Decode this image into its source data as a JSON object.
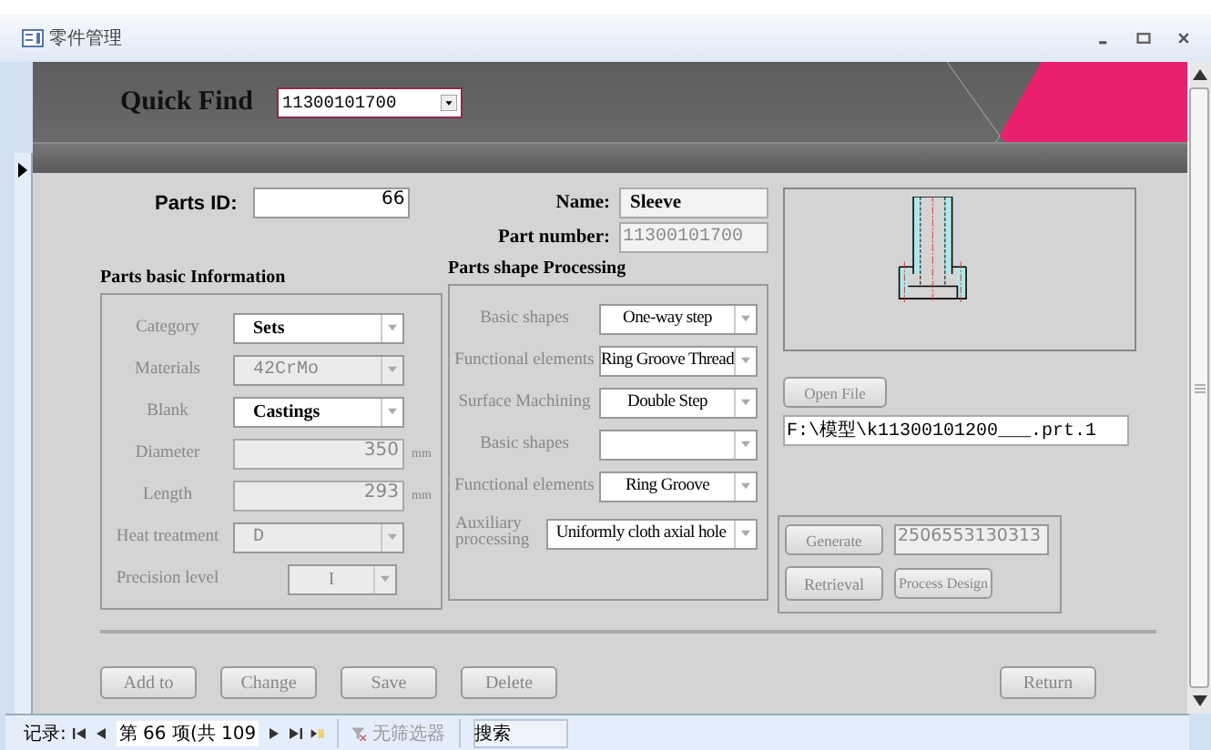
{
  "window": {
    "title": "零件管理"
  },
  "quick_find": {
    "label": "Quick Find",
    "value": "11300101700"
  },
  "parts_id": {
    "label": "Parts ID:",
    "value": "66"
  },
  "name": {
    "label": "Name:",
    "value": "Sleeve"
  },
  "part_number": {
    "label": "Part number:",
    "value": "11300101700"
  },
  "basic_info": {
    "title": "Parts basic Information",
    "fields": [
      {
        "label": "Category",
        "value": "Sets",
        "kind": "combo",
        "disabled": false
      },
      {
        "label": "Materials",
        "value": "42CrMo",
        "kind": "combo",
        "disabled": true
      },
      {
        "label": "Blank",
        "value": "Castings",
        "kind": "combo",
        "disabled": false
      },
      {
        "label": "Diameter",
        "value": "350",
        "kind": "number",
        "unit": "mm",
        "disabled": true
      },
      {
        "label": "Length",
        "value": "293",
        "kind": "number",
        "unit": "mm",
        "disabled": true
      },
      {
        "label": "Heat treatment",
        "value": "D",
        "kind": "combo",
        "disabled": true
      },
      {
        "label": "Precision level",
        "value": "I",
        "kind": "small-combo",
        "disabled": true
      }
    ]
  },
  "shape_processing": {
    "title": "Parts shape Processing",
    "fields": [
      {
        "label": "Basic shapes",
        "value": "One-way step",
        "kind": "combo"
      },
      {
        "label": "Functional elements",
        "value": "Ring Groove Thread",
        "kind": "combo"
      },
      {
        "label": "Surface Machining",
        "value": "Double Step",
        "kind": "combo"
      },
      {
        "label": "Basic shapes",
        "kind": "combo"
      },
      {
        "label": "Functional elements",
        "value": "Ring Groove",
        "kind": "combo"
      },
      {
        "label": "Auxiliary processing",
        "value": "Uniformly cloth axial hole",
        "kind": "wide-combo"
      }
    ]
  },
  "open_file": {
    "button": "Open File",
    "path": "F:\\模型\\k11300101200___.prt.1"
  },
  "generate": {
    "button": "Generate",
    "code": "2506553130313",
    "retrieval": "Retrieval",
    "process_design": "Process Design"
  },
  "buttons": [
    "Add to",
    "Change",
    "Save",
    "Delete"
  ],
  "return_button": "Return",
  "navigation": {
    "label": "记录:",
    "position": "第 66 项(共 109",
    "filter": "无筛选器",
    "search": "搜索"
  }
}
